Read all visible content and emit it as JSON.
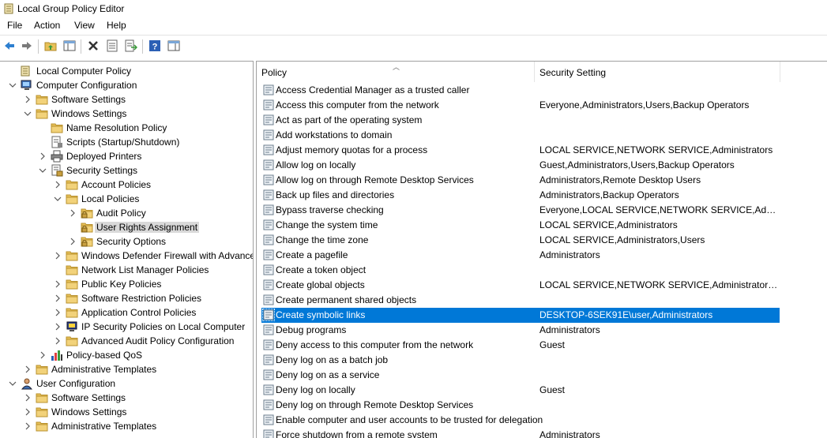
{
  "window": {
    "title": "Local Group Policy Editor"
  },
  "menu": [
    "File",
    "Action",
    "View",
    "Help"
  ],
  "toolbar": [
    {
      "name": "back-icon",
      "icon": "arrow-left"
    },
    {
      "name": "forward-icon",
      "icon": "arrow-right"
    },
    {
      "name": "up-folder-icon",
      "icon": "folder-up"
    },
    {
      "name": "show-hide-tree-icon",
      "icon": "console-tree"
    },
    {
      "name": "delete-icon",
      "icon": "x"
    },
    {
      "name": "properties-icon",
      "icon": "properties"
    },
    {
      "name": "export-list-icon",
      "icon": "export"
    },
    {
      "name": "help-icon",
      "icon": "help"
    },
    {
      "name": "action-pane-icon",
      "icon": "action-pane"
    }
  ],
  "tree": [
    {
      "label": "Local Computer Policy",
      "level": 0,
      "arrow": "none",
      "icon": "computer"
    },
    {
      "label": "Computer Configuration",
      "level": 0,
      "arrow": "down",
      "icon": "computer-config"
    },
    {
      "label": "Software Settings",
      "level": 1,
      "arrow": "right",
      "icon": "folder"
    },
    {
      "label": "Windows Settings",
      "level": 1,
      "arrow": "down",
      "icon": "folder"
    },
    {
      "label": "Name Resolution Policy",
      "level": 2,
      "arrow": "none",
      "icon": "folder"
    },
    {
      "label": "Scripts (Startup/Shutdown)",
      "level": 2,
      "arrow": "none",
      "icon": "script"
    },
    {
      "label": "Deployed Printers",
      "level": 2,
      "arrow": "right",
      "icon": "printer"
    },
    {
      "label": "Security Settings",
      "level": 2,
      "arrow": "down",
      "icon": "security"
    },
    {
      "label": "Account Policies",
      "level": 3,
      "arrow": "right",
      "icon": "folder"
    },
    {
      "label": "Local Policies",
      "level": 3,
      "arrow": "down",
      "icon": "folder"
    },
    {
      "label": "Audit Policy",
      "level": 4,
      "arrow": "right",
      "icon": "lock-folder"
    },
    {
      "label": "User Rights Assignment",
      "level": 4,
      "arrow": "none",
      "icon": "lock-folder",
      "selected": true
    },
    {
      "label": "Security Options",
      "level": 4,
      "arrow": "right",
      "icon": "lock-folder"
    },
    {
      "label": "Windows Defender Firewall with Advanced Security",
      "level": 3,
      "arrow": "right",
      "icon": "folder"
    },
    {
      "label": "Network List Manager Policies",
      "level": 3,
      "arrow": "none",
      "icon": "folder"
    },
    {
      "label": "Public Key Policies",
      "level": 3,
      "arrow": "right",
      "icon": "folder"
    },
    {
      "label": "Software Restriction Policies",
      "level": 3,
      "arrow": "right",
      "icon": "folder"
    },
    {
      "label": "Application Control Policies",
      "level": 3,
      "arrow": "right",
      "icon": "folder"
    },
    {
      "label": "IP Security Policies on Local Computer",
      "level": 3,
      "arrow": "right",
      "icon": "ipsec"
    },
    {
      "label": "Advanced Audit Policy Configuration",
      "level": 3,
      "arrow": "right",
      "icon": "folder"
    },
    {
      "label": "Policy-based QoS",
      "level": 2,
      "arrow": "right",
      "icon": "chart"
    },
    {
      "label": "Administrative Templates",
      "level": 1,
      "arrow": "right",
      "icon": "folder"
    },
    {
      "label": "User Configuration",
      "level": 0,
      "arrow": "down",
      "icon": "user-config"
    },
    {
      "label": "Software Settings",
      "level": 1,
      "arrow": "right",
      "icon": "folder"
    },
    {
      "label": "Windows Settings",
      "level": 1,
      "arrow": "right",
      "icon": "folder"
    },
    {
      "label": "Administrative Templates",
      "level": 1,
      "arrow": "right",
      "icon": "folder"
    }
  ],
  "list": {
    "columns": [
      "Policy",
      "Security Setting"
    ],
    "rows": [
      {
        "policy": "Access Credential Manager as a trusted caller",
        "setting": ""
      },
      {
        "policy": "Access this computer from the network",
        "setting": "Everyone,Administrators,Users,Backup Operators"
      },
      {
        "policy": "Act as part of the operating system",
        "setting": ""
      },
      {
        "policy": "Add workstations to domain",
        "setting": ""
      },
      {
        "policy": "Adjust memory quotas for a process",
        "setting": "LOCAL SERVICE,NETWORK SERVICE,Administrators"
      },
      {
        "policy": "Allow log on locally",
        "setting": "Guest,Administrators,Users,Backup Operators"
      },
      {
        "policy": "Allow log on through Remote Desktop Services",
        "setting": "Administrators,Remote Desktop Users"
      },
      {
        "policy": "Back up files and directories",
        "setting": "Administrators,Backup Operators"
      },
      {
        "policy": "Bypass traverse checking",
        "setting": "Everyone,LOCAL SERVICE,NETWORK SERVICE,Administrators,Users,Backup Operators"
      },
      {
        "policy": "Change the system time",
        "setting": "LOCAL SERVICE,Administrators"
      },
      {
        "policy": "Change the time zone",
        "setting": "LOCAL SERVICE,Administrators,Users"
      },
      {
        "policy": "Create a pagefile",
        "setting": "Administrators"
      },
      {
        "policy": "Create a token object",
        "setting": ""
      },
      {
        "policy": "Create global objects",
        "setting": "LOCAL SERVICE,NETWORK SERVICE,Administrators,SERVICE"
      },
      {
        "policy": "Create permanent shared objects",
        "setting": ""
      },
      {
        "policy": "Create symbolic links",
        "setting": "DESKTOP-6SEK91E\\user,Administrators",
        "selected": true
      },
      {
        "policy": "Debug programs",
        "setting": "Administrators"
      },
      {
        "policy": "Deny access to this computer from the network",
        "setting": "Guest"
      },
      {
        "policy": "Deny log on as a batch job",
        "setting": ""
      },
      {
        "policy": "Deny log on as a service",
        "setting": ""
      },
      {
        "policy": "Deny log on locally",
        "setting": "Guest"
      },
      {
        "policy": "Deny log on through Remote Desktop Services",
        "setting": ""
      },
      {
        "policy": "Enable computer and user accounts to be trusted for delegation",
        "setting": ""
      },
      {
        "policy": "Force shutdown from a remote system",
        "setting": "Administrators"
      }
    ]
  },
  "colors": {
    "selection": "#0078d7",
    "tree_selection": "#d9d9d9",
    "folder": "#e8c158"
  }
}
